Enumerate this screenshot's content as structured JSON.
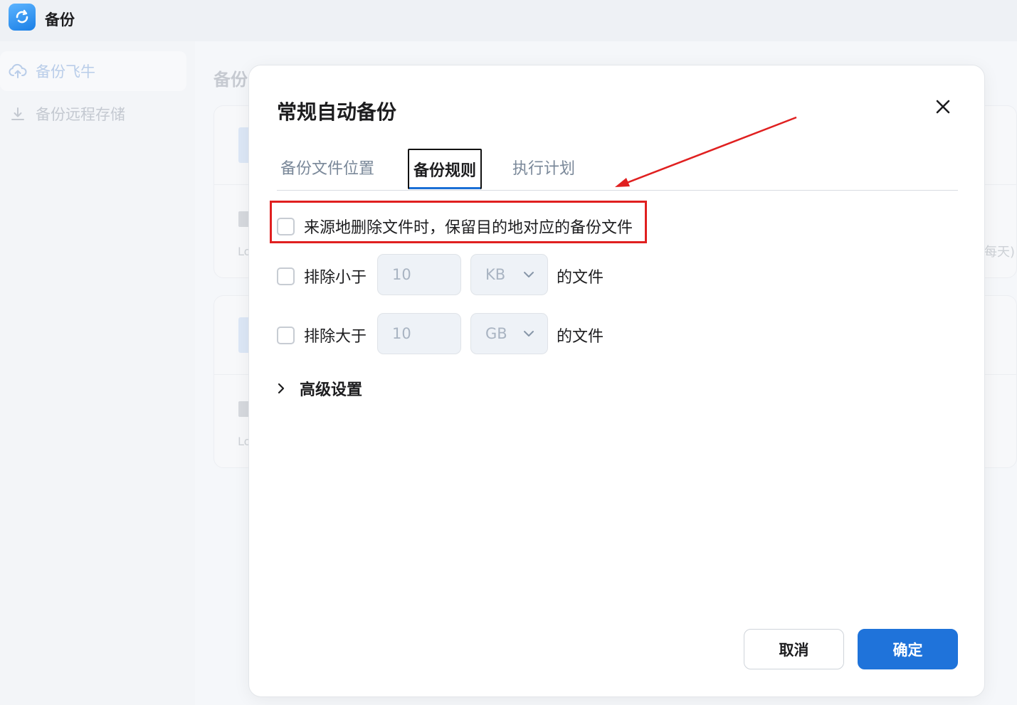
{
  "app": {
    "title": "备份"
  },
  "sidebar": {
    "items": [
      {
        "label": "备份飞牛",
        "icon": "cloud-upload-icon",
        "active": true
      },
      {
        "label": "备份远程存储",
        "icon": "download-icon",
        "active": false
      }
    ]
  },
  "background": {
    "main_title": "备份",
    "card_text": "Lo",
    "right_text": "每天)"
  },
  "dialog": {
    "title": "常规自动备份",
    "tabs": [
      {
        "label": "备份文件位置",
        "active": false
      },
      {
        "label": "备份规则",
        "active": true
      },
      {
        "label": "执行计划",
        "active": false
      }
    ],
    "rules": {
      "keep_backup": {
        "label": "来源地删除文件时，保留目的地对应的备份文件",
        "checked": false
      },
      "exclude_smaller": {
        "label": "排除小于",
        "value": "10",
        "unit": "KB",
        "suffix": "的文件",
        "checked": false
      },
      "exclude_larger": {
        "label": "排除大于",
        "value": "10",
        "unit": "GB",
        "suffix": "的文件",
        "checked": false
      }
    },
    "advanced_label": "高级设置",
    "cancel_label": "取消",
    "ok_label": "确定"
  },
  "colors": {
    "accent": "#1f73da",
    "annotation": "#e02020"
  }
}
